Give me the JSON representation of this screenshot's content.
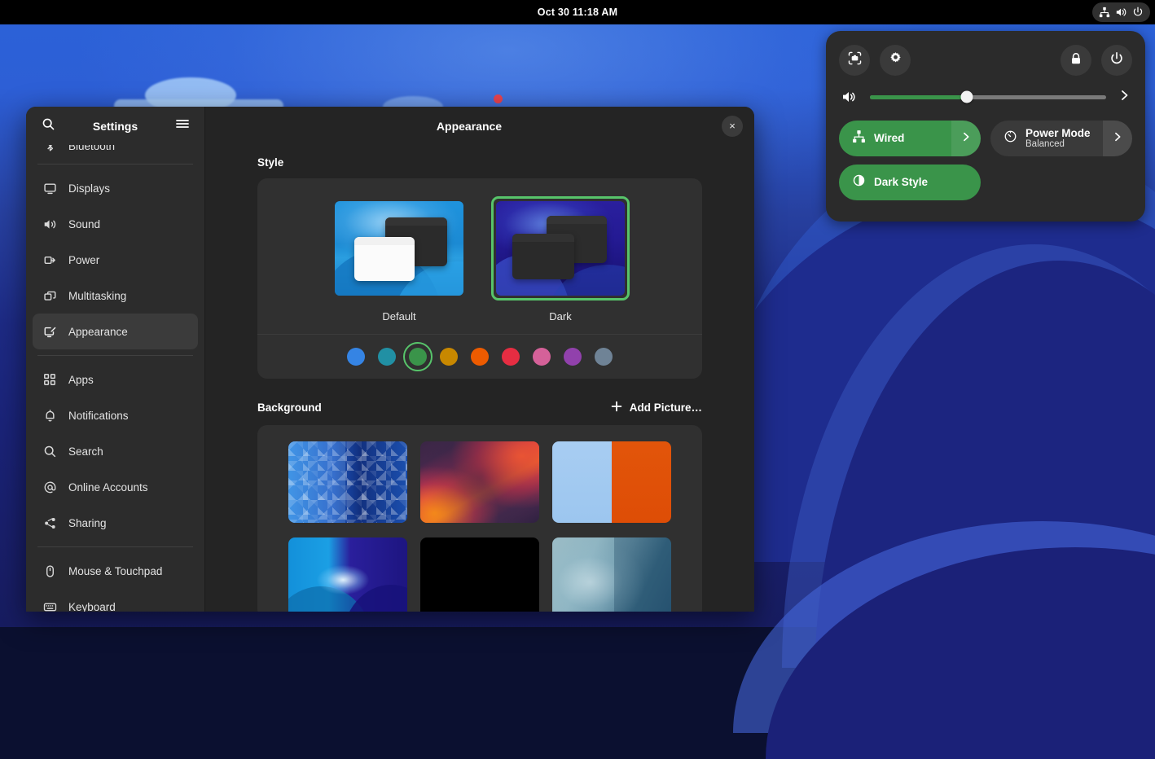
{
  "topbar": {
    "clock": "Oct 30  11:18 AM",
    "icons": [
      "network-wired-icon",
      "volume-icon",
      "power-icon"
    ]
  },
  "quick_settings": {
    "buttons": [
      {
        "name": "screenshot-icon",
        "label": "Screenshot"
      },
      {
        "name": "gear-icon",
        "label": "Settings"
      },
      {
        "name": "lock-icon",
        "label": "Lock"
      },
      {
        "name": "power-icon",
        "label": "Power Off"
      }
    ],
    "volume": {
      "icon": "volume-icon",
      "value": 41,
      "arrow": "chevron-right-icon"
    },
    "tiles": [
      {
        "id": "wired",
        "label": "Wired",
        "sublabel": "",
        "icon": "network-wired-icon",
        "active": true,
        "has_arrow": true
      },
      {
        "id": "power-mode",
        "label": "Power Mode",
        "sublabel": "Balanced",
        "icon": "speedometer-icon",
        "active": false,
        "has_arrow": true
      },
      {
        "id": "dark-style",
        "label": "Dark Style",
        "sublabel": "",
        "icon": "contrast-icon",
        "active": true,
        "has_arrow": false
      }
    ]
  },
  "window": {
    "sidebar_title": "Settings",
    "content_title": "Appearance",
    "close_label": "×",
    "search_icon": "search-icon",
    "menu_icon": "hamburger-menu-icon"
  },
  "sidebar": {
    "groups": [
      {
        "items": [
          {
            "label": "Bluetooth",
            "icon": "bluetooth-icon",
            "selected": false
          }
        ]
      },
      {
        "items": [
          {
            "label": "Displays",
            "icon": "display-icon",
            "selected": false
          },
          {
            "label": "Sound",
            "icon": "sound-icon",
            "selected": false
          },
          {
            "label": "Power",
            "icon": "power-plug-icon",
            "selected": false
          },
          {
            "label": "Multitasking",
            "icon": "multitasking-icon",
            "selected": false
          },
          {
            "label": "Appearance",
            "icon": "appearance-icon",
            "selected": true
          }
        ]
      },
      {
        "items": [
          {
            "label": "Apps",
            "icon": "apps-grid-icon",
            "selected": false
          },
          {
            "label": "Notifications",
            "icon": "bell-icon",
            "selected": false
          },
          {
            "label": "Search",
            "icon": "search-icon",
            "selected": false
          },
          {
            "label": "Online Accounts",
            "icon": "at-sign-icon",
            "selected": false
          },
          {
            "label": "Sharing",
            "icon": "share-icon",
            "selected": false
          }
        ]
      },
      {
        "items": [
          {
            "label": "Mouse & Touchpad",
            "icon": "mouse-icon",
            "selected": false
          },
          {
            "label": "Keyboard",
            "icon": "keyboard-icon",
            "selected": false
          }
        ]
      }
    ]
  },
  "appearance": {
    "style": {
      "title": "Style",
      "choices": [
        {
          "id": "default",
          "label": "Default",
          "selected": false
        },
        {
          "id": "dark",
          "label": "Dark",
          "selected": true
        }
      ],
      "accent_colors": [
        {
          "name": "blue",
          "hex": "#3584e4",
          "selected": false
        },
        {
          "name": "teal",
          "hex": "#2190a4",
          "selected": false
        },
        {
          "name": "green",
          "hex": "#3a944a",
          "selected": true
        },
        {
          "name": "yellow",
          "hex": "#c88800",
          "selected": false
        },
        {
          "name": "orange",
          "hex": "#ed5b00",
          "selected": false
        },
        {
          "name": "red",
          "hex": "#e62d42",
          "selected": false
        },
        {
          "name": "pink",
          "hex": "#d56199",
          "selected": false
        },
        {
          "name": "purple",
          "hex": "#9141ac",
          "selected": false
        },
        {
          "name": "slate",
          "hex": "#6f8396",
          "selected": false
        }
      ]
    },
    "background": {
      "title": "Background",
      "add_picture_label": "Add Picture…",
      "add_icon": "plus-icon",
      "thumbnails": [
        {
          "id": "blue-triangles",
          "style": "triangles",
          "selected": false
        },
        {
          "id": "red-purple-waves",
          "style": "waves",
          "selected": false
        },
        {
          "id": "blue-orange-split",
          "style": "blueorange",
          "selected": false
        },
        {
          "id": "blue-night",
          "style": "night",
          "selected": false
        },
        {
          "id": "black",
          "style": "black",
          "selected": false
        },
        {
          "id": "teal-abstract",
          "style": "teal",
          "selected": false
        }
      ]
    }
  },
  "colors": {
    "accent_green": "#3a944a",
    "selection_green": "#57c46a",
    "window_bg": "#242424",
    "sidebar_bg": "#2c2c2c",
    "card_bg": "#303030",
    "panel_bg": "#2b2b2b"
  }
}
